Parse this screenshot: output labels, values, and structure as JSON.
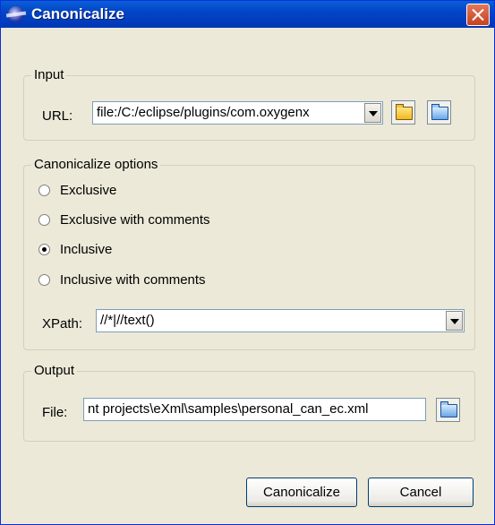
{
  "dialog": {
    "title": "Canonicalize",
    "app_icon": "eclipse-icon",
    "close_icon": "close-icon"
  },
  "input_group": {
    "legend": "Input",
    "url_label": "URL:",
    "url_value": "file:/C:/eclipse/plugins/com.oxygenx",
    "open_icon": "folder-open-icon",
    "browse_icon": "folder-browse-icon"
  },
  "options_group": {
    "legend": "Canonicalize options",
    "radios": [
      {
        "label": "Exclusive",
        "checked": false
      },
      {
        "label": "Exclusive with comments",
        "checked": false
      },
      {
        "label": "Inclusive",
        "checked": true
      },
      {
        "label": "Inclusive with comments",
        "checked": false
      }
    ],
    "xpath_label": "XPath:",
    "xpath_value": "//*|//text()"
  },
  "output_group": {
    "legend": "Output",
    "file_label": "File:",
    "file_value": "nt projects\\eXml\\samples\\personal_can_ec.xml",
    "browse_icon": "folder-browse-icon"
  },
  "buttons": {
    "ok": "Canonicalize",
    "cancel": "Cancel"
  }
}
